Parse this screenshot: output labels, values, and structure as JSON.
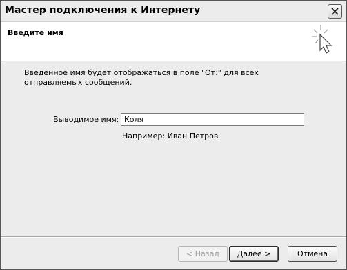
{
  "window": {
    "title": "Мастер подключения к Интернету"
  },
  "header": {
    "title": "Введите имя",
    "icon": "sparkle-cursor-icon"
  },
  "main": {
    "description": "Введенное имя будет отображаться в поле \"От:\" для всех отправляемых сообщений.",
    "display_name_label": "Выводимое имя:",
    "display_name_value": "Коля",
    "example_text": "Например: Иван Петров"
  },
  "footer": {
    "back_label": "< Назад",
    "next_label": "Далее >",
    "cancel_label": "Отмена"
  }
}
